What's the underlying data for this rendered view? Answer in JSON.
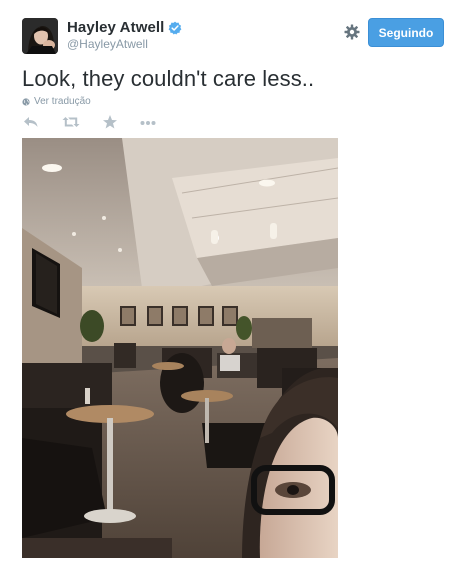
{
  "tweet": {
    "display_name": "Hayley Atwell",
    "screen_name": "@HayleyAtwell",
    "verified": true,
    "follow_label": "Seguindo",
    "text": "Look, they couldn't care less..",
    "translate_label": "Ver tradução"
  },
  "icons": {
    "verified": "verified-badge-icon",
    "settings": "gear-icon",
    "translate": "globe-icon",
    "reply": "reply-icon",
    "retweet": "retweet-icon",
    "favorite": "star-icon",
    "more": "more-icon"
  },
  "colors": {
    "follow_button": "#4a9fe3",
    "text": "#292f33",
    "muted": "#8899a6",
    "action_icons": "#b5c0c8",
    "verified": "#55acee"
  }
}
